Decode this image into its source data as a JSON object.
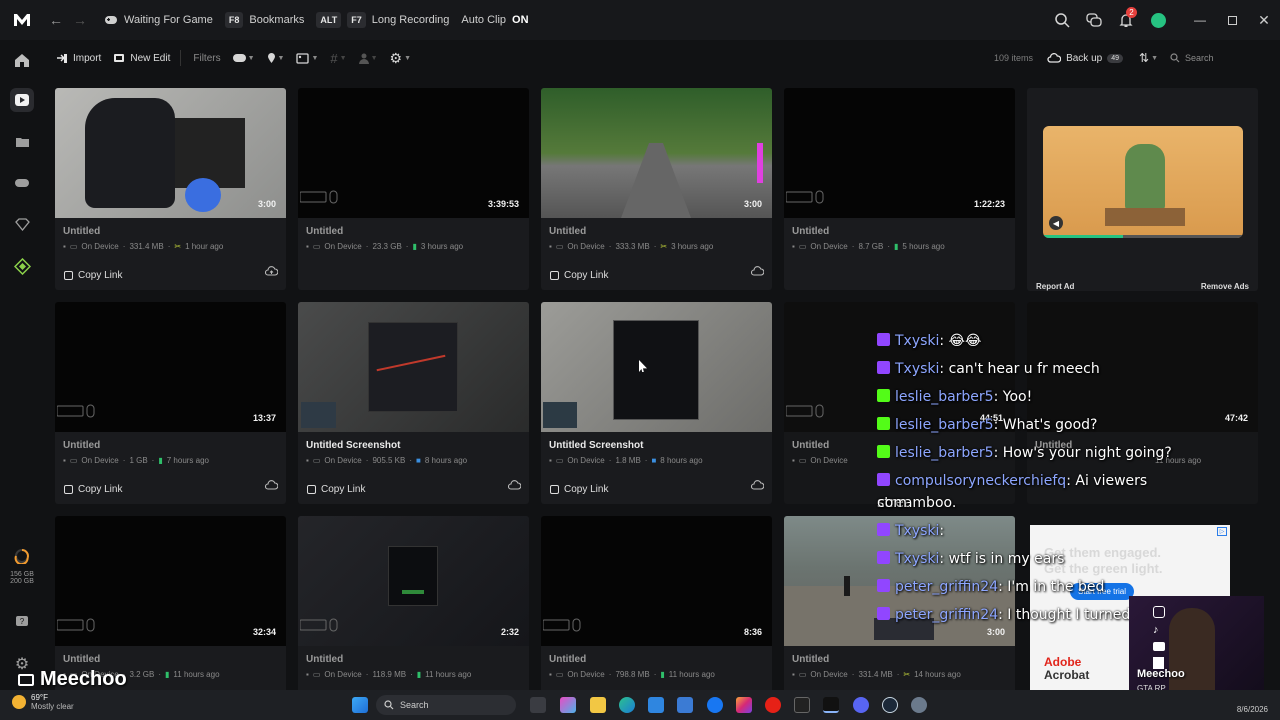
{
  "titlebar": {
    "status_text": "Waiting For Game",
    "bookmarks_key": "F8",
    "bookmarks_label": "Bookmarks",
    "long_key_mod": "ALT",
    "long_key": "F7",
    "long_label": "Long Recording",
    "autoclip_label": "Auto Clip",
    "autoclip_state": "ON",
    "notif_count": "2"
  },
  "toolbar": {
    "import_label": "Import",
    "new_edit_label": "New Edit",
    "filters_label": "Filters",
    "items_count": "109 items",
    "backup_label": "Back up",
    "backup_count": "49",
    "search_placeholder": "Search"
  },
  "storage": {
    "used": "156 GB",
    "total": "200 GB"
  },
  "cards": [
    {
      "title": "Untitled",
      "duration": "3:00",
      "location": "On Device",
      "size": "331.4 MB",
      "time": "1 hour ago",
      "copy": "Copy Link"
    },
    {
      "title": "Untitled",
      "duration": "3:39:53",
      "location": "On Device",
      "size": "23.3 GB",
      "time": "3 hours ago",
      "copy": ""
    },
    {
      "title": "Untitled",
      "duration": "3:00",
      "location": "On Device",
      "size": "333.3 MB",
      "time": "3 hours ago",
      "copy": "Copy Link"
    },
    {
      "title": "Untitled",
      "duration": "1:22:23",
      "location": "On Device",
      "size": "8.7 GB",
      "time": "5 hours ago",
      "copy": ""
    },
    {
      "title": "Untitled",
      "duration": "13:37",
      "location": "On Device",
      "size": "1 GB",
      "time": "7 hours ago",
      "copy": "Copy Link"
    },
    {
      "title": "Untitled Screenshot",
      "duration": "",
      "location": "On Device",
      "size": "905.5 KB",
      "time": "8 hours ago",
      "copy": "Copy Link"
    },
    {
      "title": "Untitled Screenshot",
      "duration": "",
      "location": "On Device",
      "size": "1.8 MB",
      "time": "8 hours ago",
      "copy": "Copy Link"
    },
    {
      "title": "Untitled",
      "duration": "44:51",
      "location": "On Device",
      "size": "",
      "time": "",
      "copy": ""
    },
    {
      "title": "Untitled",
      "duration": "47:42",
      "location": "",
      "size": "",
      "time": "11 hours ago",
      "copy": ""
    },
    {
      "title": "Untitled",
      "duration": "32:34",
      "location": "On Device",
      "size": "3.2 GB",
      "time": "11 hours ago",
      "copy": ""
    },
    {
      "title": "Untitled",
      "duration": "2:32",
      "location": "On Device",
      "size": "118.9 MB",
      "time": "11 hours ago",
      "copy": ""
    },
    {
      "title": "Untitled",
      "duration": "8:36",
      "location": "On Device",
      "size": "798.8 MB",
      "time": "11 hours ago",
      "copy": ""
    },
    {
      "title": "Untitled",
      "duration": "3:00",
      "location": "On Device",
      "size": "331.4 MB",
      "time": "14 hours ago",
      "copy": ""
    }
  ],
  "ad1": {
    "report": "Report Ad",
    "remove": "Remove Ads"
  },
  "ad2": {
    "line1": "Get them engaged.",
    "line2": "Get the green light.",
    "cta": "Start free trial",
    "brand1": "Adobe",
    "brand2": "Acrobat"
  },
  "chat": [
    {
      "user": "Txyski",
      "msg": "😂😂",
      "platform": "twitch"
    },
    {
      "user": "Txyski",
      "msg": "can't hear u fr meech",
      "platform": "twitch"
    },
    {
      "user": "leslie_barber5",
      "msg": "Yoo!",
      "platform": "kick"
    },
    {
      "user": "leslie_barber5",
      "msg": "What's good?",
      "platform": "kick"
    },
    {
      "user": "leslie_barber5",
      "msg": "How's your night going?",
      "platform": "kick"
    },
    {
      "user": "compulsoryneckerchiefq",
      "msg": "Ai viewers streamboo.",
      "msg2": "com",
      "platform": "twitch"
    },
    {
      "user": "Txyski",
      "msg": "",
      "platform": "twitch"
    },
    {
      "user": "Txyski",
      "msg": "wtf is in my ears",
      "platform": "twitch"
    },
    {
      "user": "peter_griffin24",
      "msg": "I'm in the bed",
      "platform": "twitch"
    },
    {
      "user": "peter_griffin24",
      "msg": "I thought I turned my shit off",
      "platform": "twitch"
    }
  ],
  "streamer": {
    "name": "Meechoo",
    "sub": "GTA RP",
    "watermark": "Meechoo"
  },
  "taskbar": {
    "weather_temp": "69°F",
    "weather_desc": "Mostly clear",
    "search": "Search",
    "date": "8/6/2026"
  },
  "colors": {
    "accent": "#26c281",
    "twitch": "#9146ff",
    "kick": "#53fc18",
    "chat_name": "#8da6ff",
    "notif": "#e5403d"
  }
}
